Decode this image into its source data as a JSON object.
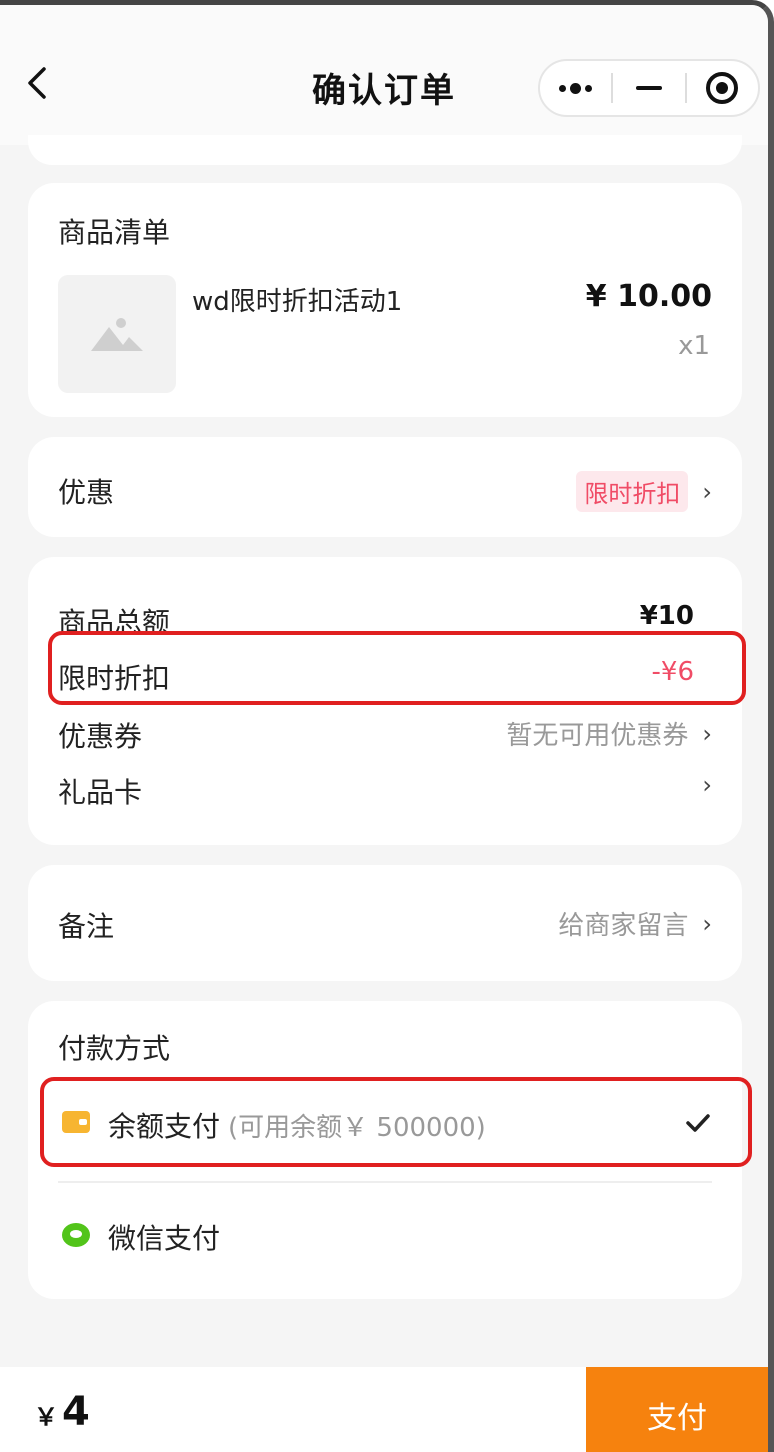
{
  "nav": {
    "title": "确认订单"
  },
  "product_list": {
    "title": "商品清单",
    "item": {
      "name": "wd限时折扣活动1",
      "price": "¥ 10.00",
      "qty": "x1"
    }
  },
  "discount": {
    "label": "优惠",
    "tag": "限时折扣"
  },
  "summary": {
    "goods_total_label": "商品总额",
    "goods_total_value": "¥10",
    "flash_sale_label": "限时折扣",
    "flash_sale_value": "-¥6",
    "coupon_label": "优惠券",
    "coupon_value": "暂无可用优惠券",
    "gift_card_label": "礼品卡"
  },
  "remark": {
    "label": "备注",
    "placeholder": "给商家留言"
  },
  "payment": {
    "title": "付款方式",
    "balance_label": "余额支付",
    "balance_sub": "(可用余额￥ 500000)",
    "wechat_label": "微信支付"
  },
  "bottom": {
    "currency": "￥",
    "amount": "4",
    "pay_label": "支付"
  },
  "colors": {
    "accent": "#f6820e",
    "discount_red": "#f04c66",
    "highlight_red": "#e02020"
  }
}
